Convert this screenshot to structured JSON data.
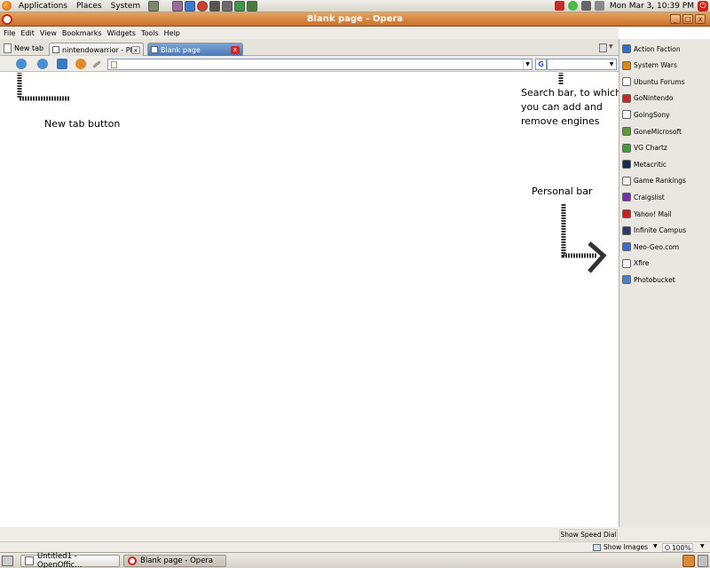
{
  "top_panel": {
    "menus": [
      "Applications",
      "Places",
      "System"
    ],
    "clock": "Mon Mar  3, 10:39 PM"
  },
  "window": {
    "title": "Blank page - Opera",
    "controls": {
      "minimize": "_",
      "maximize": "□",
      "close": "x"
    }
  },
  "menubar": {
    "items": [
      "File",
      "Edit",
      "View",
      "Bookmarks",
      "Widgets",
      "Tools",
      "Help"
    ]
  },
  "tabs": {
    "new_tab_label": "New tab",
    "items": [
      {
        "label": "nintendowarrior - Phot...",
        "active": false
      },
      {
        "label": "Blank page",
        "active": true
      }
    ],
    "close_glyph": "x"
  },
  "address_bar": {
    "value": "",
    "search_engine_glyph": "G",
    "search_value": ""
  },
  "annotations": {
    "new_tab": "New tab button",
    "search_bar": "Search bar, to which\nyou can add and\nremove engines",
    "personal_bar": "Personal bar"
  },
  "personal_bar": {
    "items": [
      {
        "label": "Action Faction",
        "color": "#2a6fd6"
      },
      {
        "label": "System Wars",
        "color": "#e08a00"
      },
      {
        "label": "Ubuntu Forums",
        "color": "#ffffff"
      },
      {
        "label": "GoNintendo",
        "color": "#d22222"
      },
      {
        "label": "GoingSony",
        "color": "#f4f4f4"
      },
      {
        "label": "GoneMicrosoft",
        "color": "#5a9a3a"
      },
      {
        "label": "VG Chartz",
        "color": "#3aa03a"
      },
      {
        "label": "Metacritic",
        "color": "#1a2a4a"
      },
      {
        "label": "Game Rankings",
        "color": "#f4f4f4"
      },
      {
        "label": "Craigslist",
        "color": "#7a2ab0"
      },
      {
        "label": "Yahoo! Mail",
        "color": "#d01c1c"
      },
      {
        "label": "Infinite Campus",
        "color": "#2a3a6a"
      },
      {
        "label": "Neo-Geo.com",
        "color": "#3a6ad0"
      },
      {
        "label": "Xfire",
        "color": "#f4f4f4"
      },
      {
        "label": "Photobucket",
        "color": "#4a80c8"
      }
    ]
  },
  "statusbar": {
    "speed_dial": "Show Speed Dial",
    "show_images": "Show Images",
    "zoom": "100%"
  },
  "taskbar": {
    "items": [
      {
        "label": "Untitled1 - OpenOffic..."
      },
      {
        "label": "Blank page - Opera"
      }
    ]
  }
}
